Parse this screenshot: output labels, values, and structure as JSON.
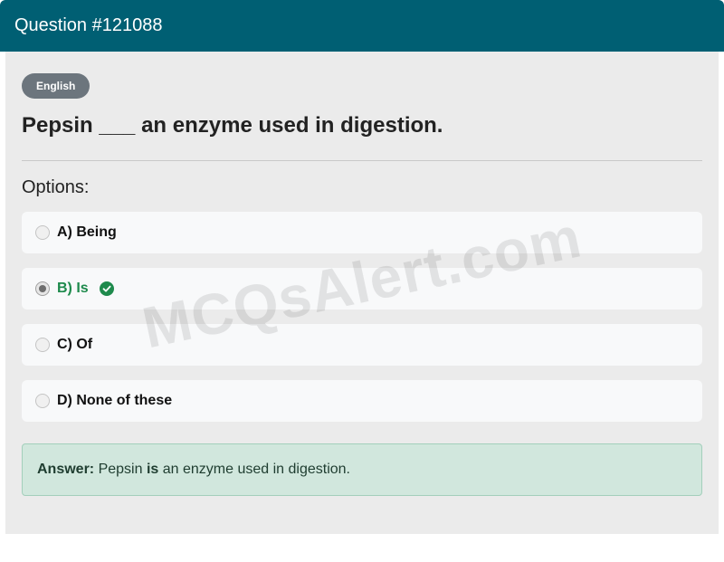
{
  "header": {
    "title": "Question #121088"
  },
  "badge": {
    "label": "English"
  },
  "question": {
    "text": "Pepsin ___ an enzyme used in digestion."
  },
  "options_label": "Options:",
  "options": [
    {
      "label": "A) Being",
      "correct": false
    },
    {
      "label": "B) Is",
      "correct": true
    },
    {
      "label": "C) Of",
      "correct": false
    },
    {
      "label": "D) None of these",
      "correct": false
    }
  ],
  "answer": {
    "prefix": "Answer:",
    "before": "Pepsin",
    "highlight": "is",
    "after": "an enzyme used in digestion."
  },
  "watermark": "MCQsAlert.com",
  "colors": {
    "header_bg": "#005f73",
    "correct": "#1e8a4c",
    "answer_bg": "#d1e7dd"
  }
}
